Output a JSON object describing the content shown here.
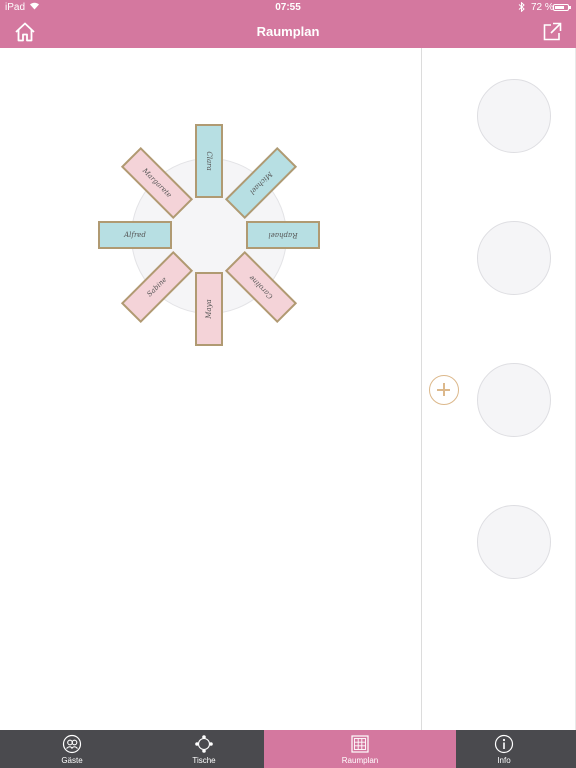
{
  "status_bar": {
    "device": "iPad",
    "time": "07:55",
    "battery_text": "72 %",
    "battery_level": 0.72
  },
  "nav": {
    "title": "Raumplan",
    "home_icon": "home-icon",
    "share_icon": "share-icon"
  },
  "floor_plan": {
    "guests": [
      {
        "name": "Clara",
        "color": "blue"
      },
      {
        "name": "Michael",
        "color": "blue"
      },
      {
        "name": "Raphael",
        "color": "blue"
      },
      {
        "name": "Caroline",
        "color": "pink"
      },
      {
        "name": "Maya",
        "color": "pink"
      },
      {
        "name": "Sabine",
        "color": "pink"
      },
      {
        "name": "Alfred",
        "color": "blue"
      },
      {
        "name": "Margarete",
        "color": "pink"
      }
    ]
  },
  "side_panel": {
    "slot_count": 4,
    "add_icon": "plus-circle-icon"
  },
  "tabs": [
    {
      "label": "Gäste",
      "icon": "guests-icon",
      "active": false
    },
    {
      "label": "Tische",
      "icon": "tables-icon",
      "active": false
    },
    {
      "label": "Raumplan",
      "icon": "floorplan-grid-icon",
      "active": true
    },
    {
      "label": "Info",
      "icon": "info-icon",
      "active": false
    }
  ],
  "colors": {
    "brand_pink": "#d4789f",
    "tabbar_dark": "#4a4a4e",
    "card_blue": "#b7dfe3",
    "card_pink": "#f4d3d8",
    "card_border": "#b09a72",
    "accent_gold": "#dcb88b"
  }
}
